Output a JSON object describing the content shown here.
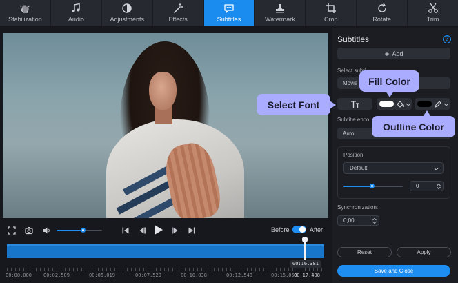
{
  "toolbar": {
    "tabs": [
      {
        "label": "Stabilization",
        "icon": "stabilization-hand-icon"
      },
      {
        "label": "Audio",
        "icon": "music-note-icon"
      },
      {
        "label": "Adjustments",
        "icon": "contrast-icon"
      },
      {
        "label": "Effects",
        "icon": "magic-wand-icon"
      },
      {
        "label": "Subtitles",
        "icon": "speech-bubble-icon",
        "active": true
      },
      {
        "label": "Watermark",
        "icon": "stamp-icon"
      },
      {
        "label": "Crop",
        "icon": "crop-icon"
      },
      {
        "label": "Rotate",
        "icon": "rotate-icon"
      },
      {
        "label": "Trim",
        "icon": "scissors-icon"
      }
    ]
  },
  "sidebar": {
    "title": "Subtitles",
    "add_label": "Add",
    "select_subtitle_label": "Select subti",
    "subtitle_value": "Movie",
    "encoding_label": "Subtitle enco",
    "encoding_value": "Auto",
    "position_label": "Position:",
    "position_value": "Default",
    "position_slider": 0.5,
    "position_number": "0",
    "sync_label": "Synchronization:",
    "sync_value": "0,00",
    "reset_label": "Reset",
    "apply_label": "Apply",
    "save_label": "Save and Close",
    "fill_color": "#ffffff",
    "outline_color": "#000000"
  },
  "callouts": {
    "fill_color": "Fill Color",
    "select_font": "Select Font",
    "outline_color": "Outline Color"
  },
  "player": {
    "volume": 0.6,
    "before_label": "Before",
    "after_label": "After",
    "current_time": "00:16.381",
    "ticks": [
      "00:00.000",
      "00:02.509",
      "00:05.019",
      "00:07.529",
      "00:10.038",
      "00:12.548",
      "00:15.058",
      "00:17.408"
    ]
  },
  "colors": {
    "accent": "#1e8ef2",
    "callout": "#a9acff"
  }
}
